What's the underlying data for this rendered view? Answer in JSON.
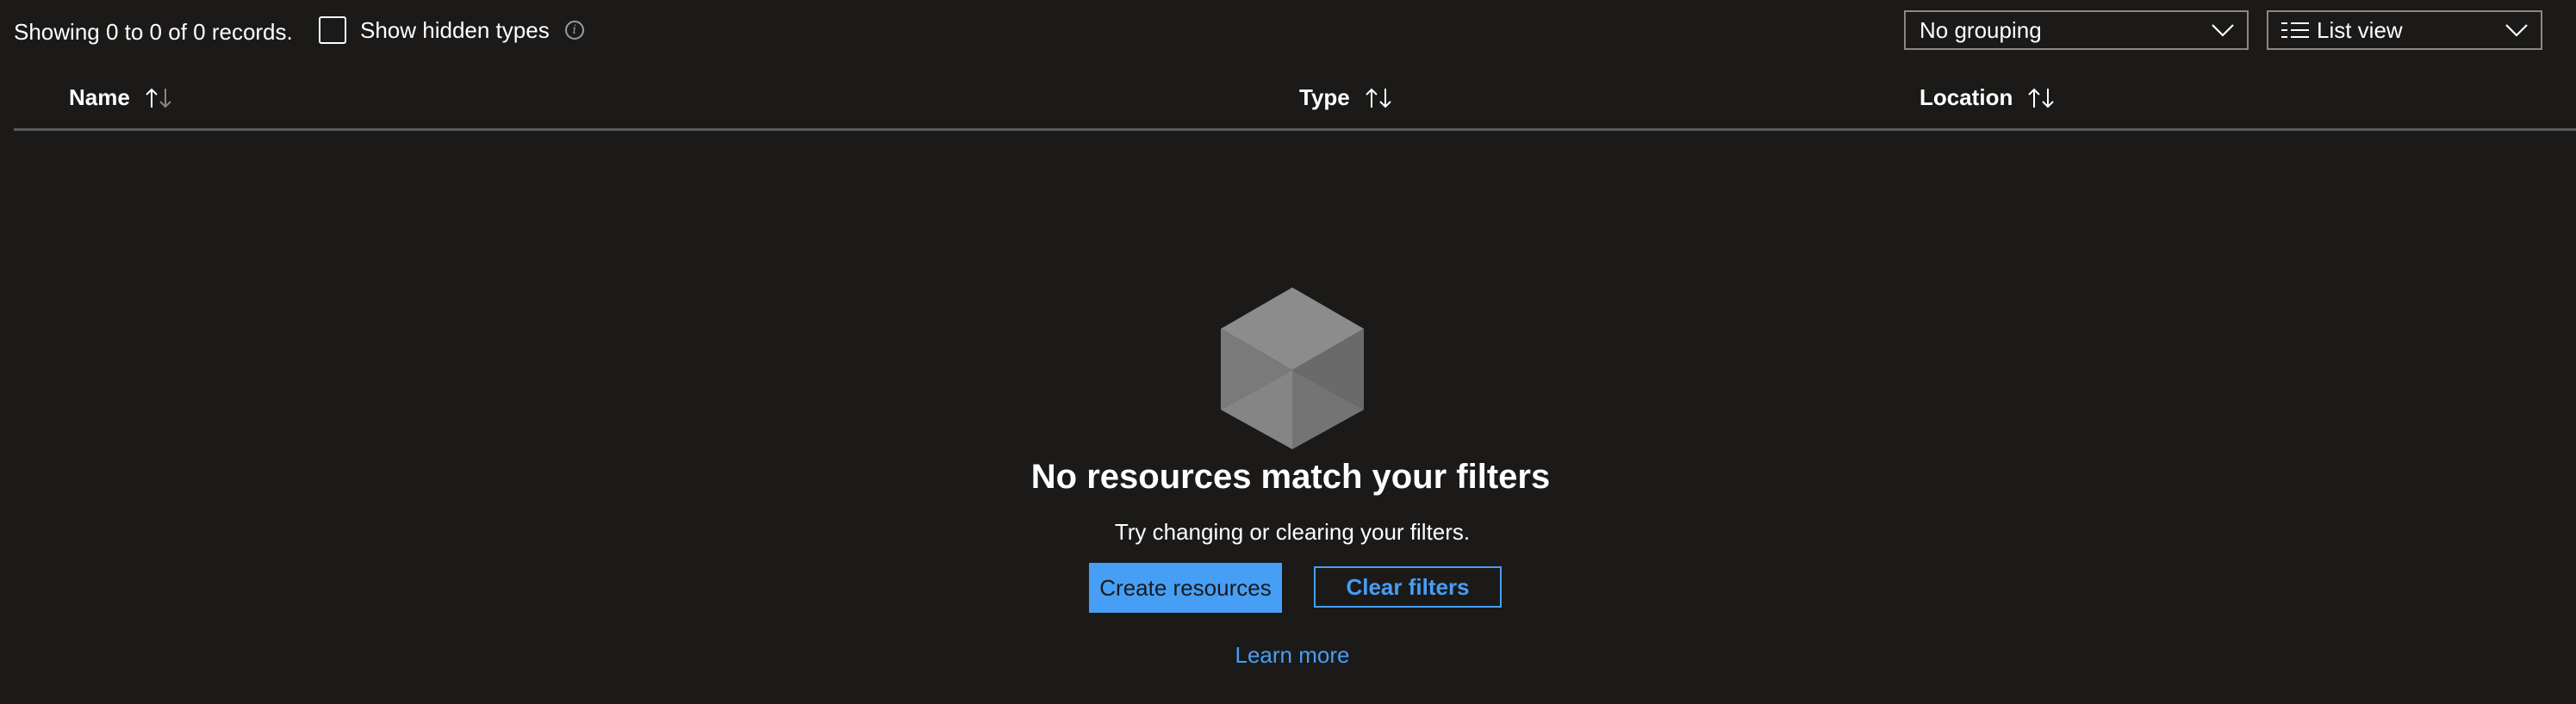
{
  "toolbar": {
    "records_text": "Showing 0 to 0 of 0 records.",
    "show_hidden_types_label": "Show hidden types",
    "show_hidden_types_checked": false,
    "info_icon": "info-icon",
    "grouping_dropdown": {
      "selected": "No grouping"
    },
    "view_dropdown": {
      "selected": "List view",
      "icon": "list-icon"
    }
  },
  "table": {
    "columns": [
      {
        "label": "Name",
        "sort_icon": "sort-arrows-icon"
      },
      {
        "label": "Type",
        "sort_icon": "sort-arrows-icon"
      },
      {
        "label": "Location",
        "sort_icon": "sort-arrows-icon"
      }
    ],
    "rows": []
  },
  "empty_state": {
    "icon": "cube-icon",
    "title": "No resources match your filters",
    "subtitle": "Try changing or clearing your filters.",
    "create_button_label": "Create resources",
    "clear_button_label": "Clear filters",
    "learn_more_label": "Learn more"
  },
  "colors": {
    "background": "#1b1a19",
    "accent": "#479ef5",
    "divider": "#5a5a5a",
    "dropdown_border": "#8a8886"
  }
}
